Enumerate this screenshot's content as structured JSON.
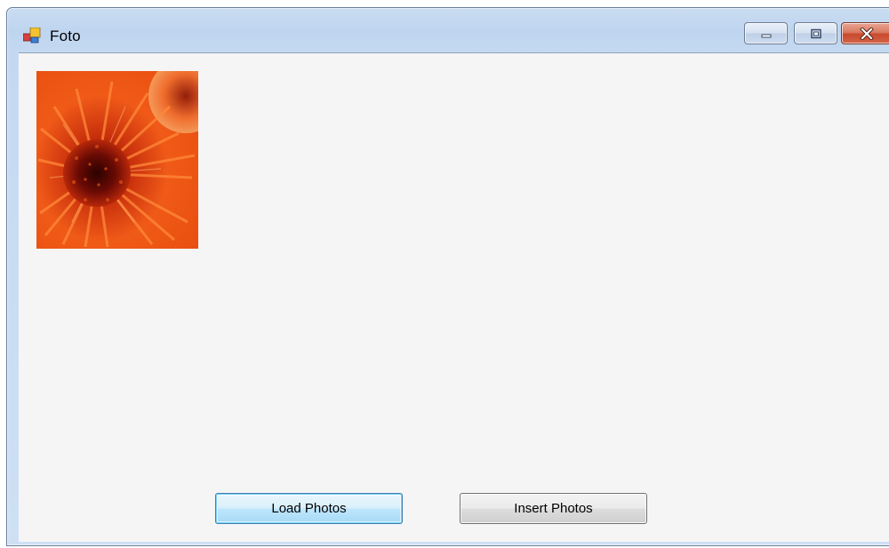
{
  "window": {
    "title": "Foto",
    "icon": "app-icon",
    "controls": {
      "minimize_icon": "minimize-icon",
      "maximize_icon": "maximize-icon",
      "close_icon": "close-icon"
    }
  },
  "main": {
    "photo": {
      "subject": "orange flower"
    },
    "buttons": {
      "load_label": "Load Photos",
      "insert_label": "Insert Photos"
    }
  },
  "colors": {
    "close_button": "#c94a2c",
    "client_background": "#f5f5f5",
    "photo_accent": "#e04a10"
  }
}
